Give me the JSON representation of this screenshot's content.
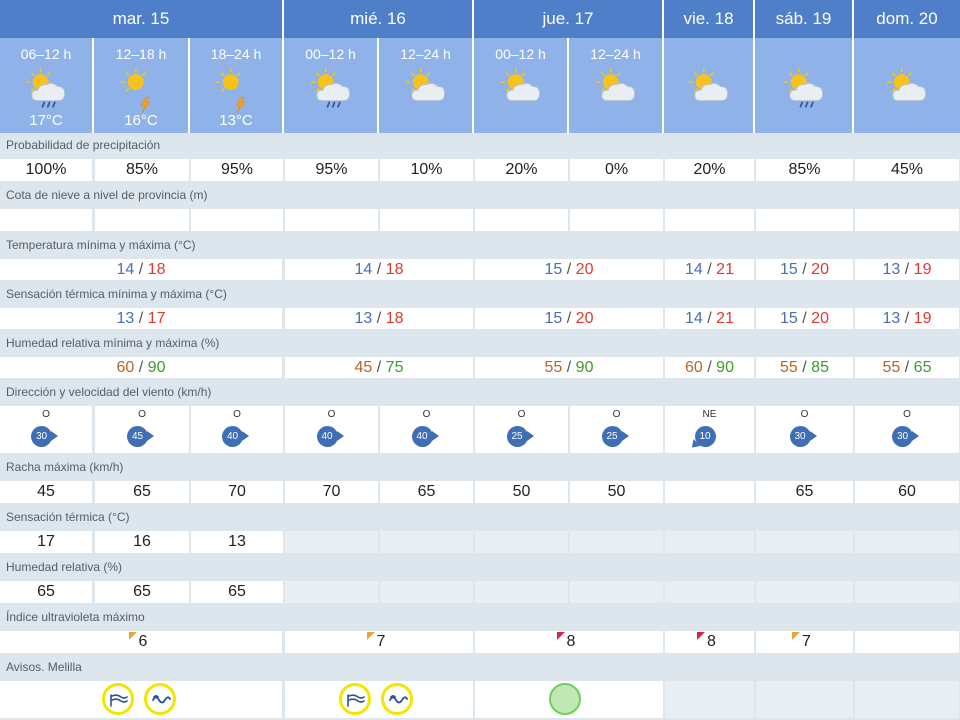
{
  "days": [
    {
      "label": "mar. 15"
    },
    {
      "label": "mié. 16"
    },
    {
      "label": "jue. 17"
    },
    {
      "label": "vie. 18"
    },
    {
      "label": "sáb. 19"
    },
    {
      "label": "dom. 20"
    }
  ],
  "periods": [
    {
      "label": "06–12 h",
      "icon": "cloud-sun-rain-icon",
      "temp": "17°C"
    },
    {
      "label": "12–18 h",
      "icon": "sun-storm-icon",
      "temp": "16°C"
    },
    {
      "label": "18–24 h",
      "icon": "sun-storm-icon",
      "temp": "13°C"
    },
    {
      "label": "00–12 h",
      "icon": "cloud-sun-rain-icon",
      "temp": ""
    },
    {
      "label": "12–24 h",
      "icon": "sun-cloud-icon",
      "temp": ""
    },
    {
      "label": "00–12 h",
      "icon": "sun-cloud-icon",
      "temp": ""
    },
    {
      "label": "12–24 h",
      "icon": "sun-cloud-icon",
      "temp": ""
    },
    {
      "label": "",
      "icon": "sun-cloud-icon",
      "temp": ""
    },
    {
      "label": "",
      "icon": "cloud-sun-rain-icon",
      "temp": ""
    },
    {
      "label": "",
      "icon": "sun-cloud-icon",
      "temp": ""
    }
  ],
  "labels": {
    "precip": "Probabilidad de precipitación",
    "snow": "Cota de nieve a nivel de provincia (m)",
    "temp": "Temperatura mínima y máxima (°C)",
    "feels": "Sensación térmica mínima y máxima (°C)",
    "humidity": "Humedad relativa mínima y máxima (%)",
    "wind": "Dirección y velocidad del viento (km/h)",
    "gust": "Racha máxima (km/h)",
    "feels_period": "Sensación térmica (°C)",
    "humidity_period": "Humedad relativa (%)",
    "uv": "Índice ultravioleta máximo",
    "warnings": "Avisos. Melilla"
  },
  "precip": [
    "100%",
    "85%",
    "95%",
    "95%",
    "10%",
    "20%",
    "0%",
    "20%",
    "85%",
    "45%"
  ],
  "temp_minmax": [
    {
      "min": "14",
      "max": "18"
    },
    {
      "min": "14",
      "max": "18"
    },
    {
      "min": "15",
      "max": "20"
    },
    {
      "min": "14",
      "max": "21"
    },
    {
      "min": "15",
      "max": "20"
    },
    {
      "min": "13",
      "max": "19"
    }
  ],
  "feels_minmax": [
    {
      "min": "13",
      "max": "17"
    },
    {
      "min": "13",
      "max": "18"
    },
    {
      "min": "15",
      "max": "20"
    },
    {
      "min": "14",
      "max": "21"
    },
    {
      "min": "15",
      "max": "20"
    },
    {
      "min": "13",
      "max": "19"
    }
  ],
  "humidity_minmax": [
    {
      "min": "60",
      "max": "90"
    },
    {
      "min": "45",
      "max": "75"
    },
    {
      "min": "55",
      "max": "90"
    },
    {
      "min": "60",
      "max": "90"
    },
    {
      "min": "55",
      "max": "85"
    },
    {
      "min": "55",
      "max": "65"
    }
  ],
  "wind": [
    {
      "dir": "O",
      "speed": "30"
    },
    {
      "dir": "O",
      "speed": "45"
    },
    {
      "dir": "O",
      "speed": "40"
    },
    {
      "dir": "O",
      "speed": "40"
    },
    {
      "dir": "O",
      "speed": "40"
    },
    {
      "dir": "O",
      "speed": "25"
    },
    {
      "dir": "O",
      "speed": "25"
    },
    {
      "dir": "NE",
      "speed": "10"
    },
    {
      "dir": "O",
      "speed": "30"
    },
    {
      "dir": "O",
      "speed": "30"
    }
  ],
  "gust": [
    "45",
    "65",
    "70",
    "70",
    "65",
    "50",
    "50",
    "",
    "65",
    "60"
  ],
  "feels_period": [
    "17",
    "16",
    "13"
  ],
  "humidity_period": [
    "65",
    "65",
    "65"
  ],
  "uv": [
    "6",
    "7",
    "8",
    "8",
    "7",
    ""
  ],
  "colors": {
    "header_dark": "#4f7fc9",
    "header_light": "#8fb3e8",
    "row_label_bg": "#dde6ec",
    "temp_min": "#4a6fb3",
    "temp_max": "#e0392f",
    "hum_min": "#b8652a",
    "hum_max": "#3f9a2e",
    "uv_moderate": "#e8a33a",
    "uv_high": "#d7263d",
    "warning_yellow": "#f2e600",
    "no_warning_green": "#6fcf59"
  }
}
